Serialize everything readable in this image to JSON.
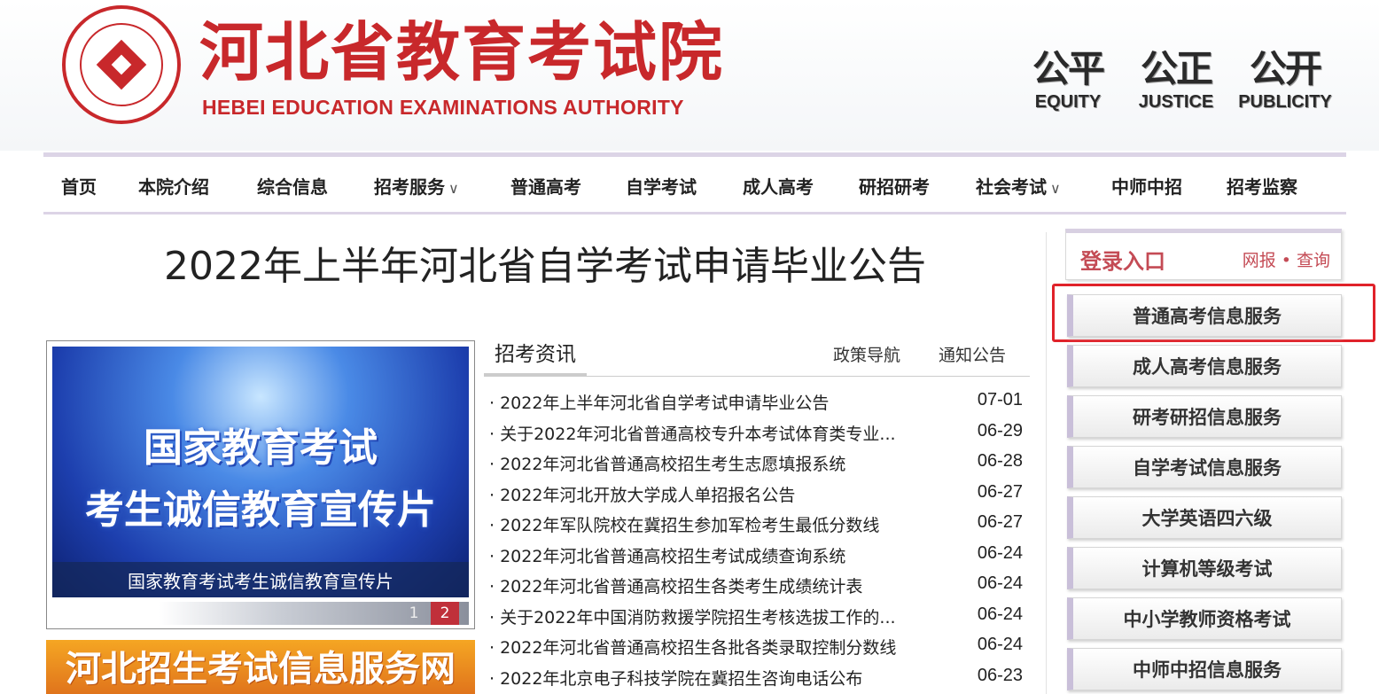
{
  "header": {
    "title_cn": "河北省教育考试院",
    "title_en": "HEBEI EDUCATION EXAMINATIONS AUTHORITY",
    "mottos": [
      {
        "cn": "公平",
        "en": "EQUITY"
      },
      {
        "cn": "公正",
        "en": "JUSTICE"
      },
      {
        "cn": "公开",
        "en": "PUBLICITY"
      }
    ]
  },
  "nav": {
    "items": [
      {
        "label": "首页"
      },
      {
        "label": "本院介绍"
      },
      {
        "label": "综合信息"
      },
      {
        "label": "招考服务",
        "dropdown": true
      },
      {
        "label": "普通高考"
      },
      {
        "label": "自学考试"
      },
      {
        "label": "成人高考"
      },
      {
        "label": "研招研考"
      },
      {
        "label": "社会考试",
        "dropdown": true
      },
      {
        "label": "中师中招"
      },
      {
        "label": "招考监察"
      }
    ],
    "chevron": "∨"
  },
  "article": {
    "title": "2022年上半年河北省自学考试申请毕业公告"
  },
  "slideshow": {
    "line1": "国家教育考试",
    "line2": "考生诚信教育宣传片",
    "caption": "国家教育考试考生诚信教育宣传片",
    "pages": [
      "1",
      "2"
    ],
    "active_page": "2"
  },
  "banner": {
    "text": "河北招生考试信息服务网"
  },
  "news": {
    "tabs": {
      "active": "招考资讯",
      "others": [
        "政策导航",
        "通知公告"
      ]
    },
    "items": [
      {
        "title": "· 2022年上半年河北省自学考试申请毕业公告",
        "date": "07-01"
      },
      {
        "title": "· 关于2022年河北省普通高校专升本考试体育类专业...",
        "date": "06-29"
      },
      {
        "title": "· 2022年河北省普通高校招生考生志愿填报系统",
        "date": "06-28"
      },
      {
        "title": "· 2022年河北开放大学成人单招报名公告",
        "date": "06-27"
      },
      {
        "title": "· 2022年军队院校在冀招生参加军检考生最低分数线",
        "date": "06-27"
      },
      {
        "title": "· 2022年河北省普通高校招生考试成绩查询系统",
        "date": "06-24"
      },
      {
        "title": "· 2022年河北省普通高校招生各类考生成绩统计表",
        "date": "06-24"
      },
      {
        "title": "· 关于2022年中国消防救援学院招生考核选拔工作的...",
        "date": "06-24"
      },
      {
        "title": "· 2022年河北省普通高校招生各批各类录取控制分数线",
        "date": "06-24"
      },
      {
        "title": "· 2022年北京电子科技学院在冀招生咨询电话公布",
        "date": "06-23"
      }
    ]
  },
  "sidebar": {
    "login_title": "登录入口",
    "login_links": "网报 • 查询",
    "services": [
      "普通高考信息服务",
      "成人高考信息服务",
      "研考研招信息服务",
      "自学考试信息服务",
      "大学英语四六级",
      "计算机等级考试",
      "中小学教师资格考试",
      "中师中招信息服务"
    ]
  },
  "colors": {
    "brand_red": "#c8282b",
    "highlight_red": "#e0222a",
    "nav_border": "#dcd4e6",
    "banner_orange": "#f08a1c"
  }
}
